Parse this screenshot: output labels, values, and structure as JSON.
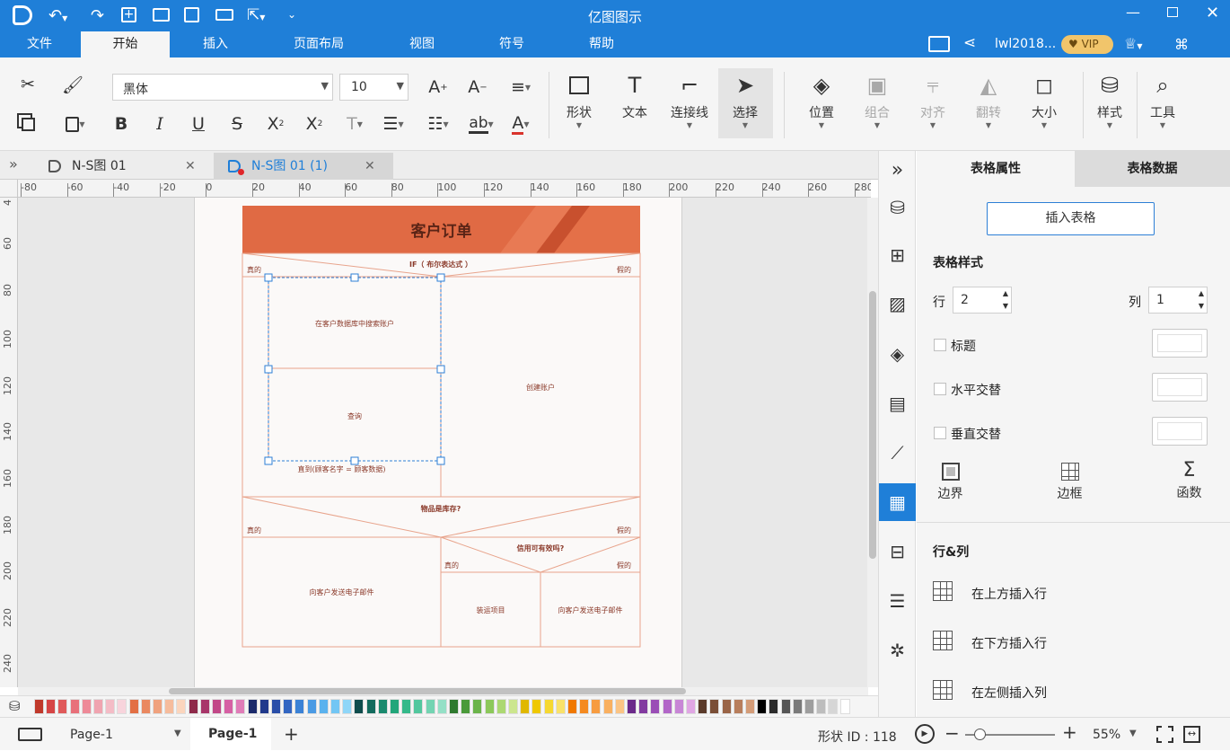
{
  "app": {
    "title": "亿图图示"
  },
  "menu": {
    "items": [
      "文件",
      "开始",
      "插入",
      "页面布局",
      "视图",
      "符号",
      "帮助"
    ],
    "active": "开始"
  },
  "account": {
    "username": "lwl2018...",
    "vip": "VIP"
  },
  "ribbon": {
    "font_name": "黑体",
    "font_size": "10",
    "groups": {
      "shape": "形状",
      "text": "文本",
      "connector": "连接线",
      "select": "选择",
      "position": "位置",
      "group": "组合",
      "align": "对齐",
      "flip": "翻转",
      "size": "大小",
      "style": "样式",
      "tools": "工具"
    }
  },
  "doc_tabs": [
    {
      "label": "N-S图 01",
      "active": false
    },
    {
      "label": "N-S图 01 (1)",
      "active": true
    }
  ],
  "ruler": {
    "h_ticks": [
      "-80",
      "-60",
      "-40",
      "-20",
      "0",
      "20",
      "40",
      "60",
      "80",
      "100",
      "120",
      "140",
      "160",
      "180",
      "200",
      "220",
      "240",
      "260",
      "280"
    ],
    "v_ticks": [
      "4",
      "60",
      "80",
      "100",
      "120",
      "140",
      "160",
      "180",
      "200",
      "220",
      "240"
    ]
  },
  "diagram": {
    "title": "客户订单",
    "if1": "IF（ 布尔表达式 ）",
    "true1": "真的",
    "false1": "假的",
    "search": "在客户数据库中搜索账户",
    "query": "查询",
    "until": "直到(顾客名字 = 顾客数据)",
    "create": "创建账户",
    "if2": "物品是库存?",
    "true2": "真的",
    "false2": "假的",
    "email1": "向客户发送电子邮件",
    "if3": "信用可有效吗?",
    "true3": "真的",
    "false3": "假的",
    "ship": "装运项目",
    "email2": "向客户发送电子邮件",
    "colors": {
      "header": "#e06a44",
      "line": "#e8a48c",
      "text": "#8b3a2a"
    }
  },
  "status": {
    "page_tab_left": "Page-1",
    "page_tab_active": "Page-1",
    "shape_id": "形状 ID : 118",
    "zoom": "55%"
  },
  "panel": {
    "tab_props": "表格属性",
    "tab_data": "表格数据",
    "insert_table": "插入表格",
    "table_style": "表格样式",
    "row_label": "行",
    "row_value": "2",
    "col_label": "列",
    "col_value": "1",
    "opt_title": "标题",
    "opt_h": "水平交替",
    "opt_v": "垂直交替",
    "tool_boundary": "边界",
    "tool_border": "边框",
    "tool_func": "函数",
    "rowcol_title": "行&列",
    "insert_above": "在上方插入行",
    "insert_below": "在下方插入行",
    "insert_left": "在左侧插入列"
  },
  "palette_colors": [
    "#c0392b",
    "#d64545",
    "#e05a5a",
    "#e8707a",
    "#ee8a98",
    "#f0a4b0",
    "#f4bcc6",
    "#f8d4dc",
    "#e36f44",
    "#ea8860",
    "#f0a27e",
    "#f6bc9c",
    "#fbd5bd",
    "#8e2a4a",
    "#a8366a",
    "#c24888",
    "#d660a4",
    "#e07cb8",
    "#1b2a6b",
    "#213a8c",
    "#2a4ea8",
    "#3366c2",
    "#3b82d6",
    "#4a9ae4",
    "#5ab2ee",
    "#72c6f4",
    "#8fd6f8",
    "#0f4d4d",
    "#136b5e",
    "#1a8a6e",
    "#22a67a",
    "#34b98a",
    "#52c79e",
    "#73d4b2",
    "#94e0c6",
    "#2f7a2f",
    "#4a9a3a",
    "#6bb44a",
    "#8cc85a",
    "#acd872",
    "#cce68e",
    "#e0b800",
    "#efc800",
    "#f6d830",
    "#f9e26a",
    "#f07800",
    "#f58a20",
    "#f79c40",
    "#f9b060",
    "#fbc484",
    "#6b2a8a",
    "#823aa0",
    "#9a4eb6",
    "#b266c8",
    "#c886d6",
    "#e0a6e4",
    "#5a3a2a",
    "#7a4e36",
    "#9a6446",
    "#b87e5c",
    "#d49c78",
    "#000000",
    "#2b2b2b",
    "#555555",
    "#7a7a7a",
    "#9e9e9e",
    "#bdbdbd",
    "#d6d6d6",
    "#ffffff"
  ]
}
